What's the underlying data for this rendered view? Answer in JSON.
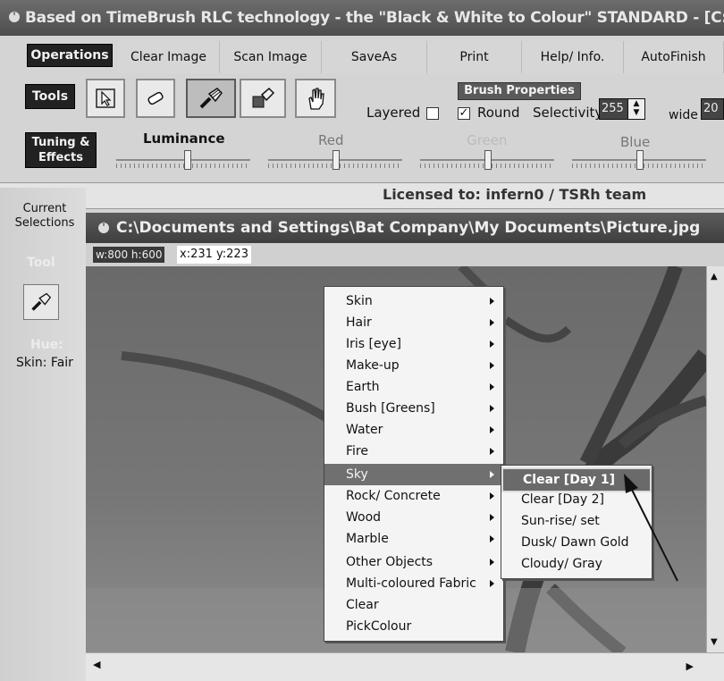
{
  "window": {
    "title": "Based on TimeBrush RLC technology - the \"Black & White to Colour\" STANDARD - [C:\\Do"
  },
  "menu": {
    "operations": "Operations",
    "clear_image": "Clear Image",
    "scan_image": "Scan Image",
    "save_as": "SaveAs",
    "print": "Print",
    "help_info": "Help/ Info.",
    "auto_finish": "AutoFinish"
  },
  "tools": {
    "label": "Tools",
    "buttons": [
      "select-arrow-icon",
      "eraser-icon",
      "brush-icon",
      "fill-icon",
      "hand-icon"
    ],
    "pressed_index": 2
  },
  "brush_properties": {
    "title": "Brush Properties",
    "layered_label": "Layered",
    "layered_checked": false,
    "round_label": "Round",
    "round_checked": true,
    "selectivity_label": "Selectivity",
    "selectivity_value": "255",
    "wide_label": "wide",
    "wide_value": "20"
  },
  "tuning": {
    "label": "Tuning & Effects",
    "sliders": [
      {
        "label": "Luminance",
        "level": 0.53
      },
      {
        "label": "Red",
        "level": 0.5
      },
      {
        "label": "Green",
        "level": 0.5
      },
      {
        "label": "Blue",
        "level": 0.5
      }
    ]
  },
  "status": {
    "licensed": "Licensed to: infern0 / TSRh team"
  },
  "left_panel": {
    "current_selections": "Current Selections",
    "tool_label": "Tool",
    "hue_label": "Hue:",
    "hue_value": "Skin: Fair"
  },
  "picture_window": {
    "title": "C:\\Documents and Settings\\Bat Company\\My Documents\\Picture.jpg",
    "size_text": "w:800  h:600",
    "coord_text": "x:231  y:223"
  },
  "context_menu": {
    "items": [
      {
        "label": "Skin",
        "submenu": true
      },
      {
        "label": "Hair",
        "submenu": true
      },
      {
        "label": "Iris [eye]",
        "submenu": true
      },
      {
        "label": "Make-up",
        "submenu": true
      },
      {
        "label": "Earth",
        "submenu": true
      },
      {
        "label": "Bush [Greens]",
        "submenu": true
      },
      {
        "label": "Water",
        "submenu": true
      },
      {
        "label": "Fire",
        "submenu": true
      },
      {
        "label": "Sky",
        "submenu": true
      },
      {
        "label": "Rock/ Concrete",
        "submenu": true
      },
      {
        "label": "Wood",
        "submenu": true
      },
      {
        "label": "Marble",
        "submenu": true
      },
      {
        "label": "Other Objects",
        "submenu": true
      },
      {
        "label": "Multi-coloured Fabric",
        "submenu": true
      },
      {
        "label": "Clear",
        "submenu": false
      },
      {
        "label": "PickColour",
        "submenu": false
      }
    ],
    "selected_index": 8
  },
  "sky_submenu": {
    "items": [
      "Clear [Day 1]",
      "Clear [Day 2]",
      "Sun-rise/ set",
      "Dusk/ Dawn Gold",
      "Cloudy/ Gray"
    ],
    "selected_index": 0
  }
}
